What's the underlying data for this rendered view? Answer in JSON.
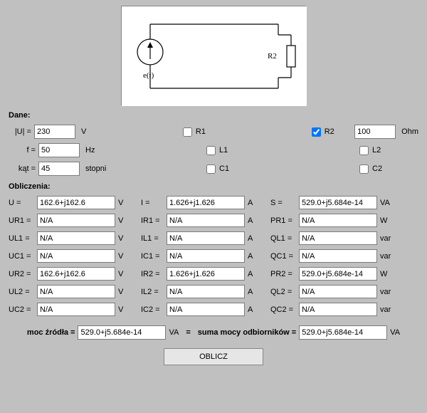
{
  "schematic": {
    "source_label": "e(t)",
    "load_label": "R2"
  },
  "sections": {
    "dane": "Dane:",
    "obliczenia": "Obliczenia:"
  },
  "dane": {
    "u_label": "|U| =",
    "u_value": "230",
    "u_unit": "V",
    "f_label": "f =",
    "f_value": "50",
    "f_unit": "Hz",
    "a_label": "kąt =",
    "a_value": "45",
    "a_unit": "stopni",
    "r1_label": "R1",
    "r1_checked": false,
    "l1_label": "L1",
    "l1_checked": false,
    "c1_label": "C1",
    "c1_checked": false,
    "r2_label": "R2",
    "r2_checked": true,
    "r2_value": "100",
    "r2_unit": "Ohm",
    "l2_label": "L2",
    "l2_checked": false,
    "c2_label": "C2",
    "c2_checked": false
  },
  "obl": {
    "col1_unit": "V",
    "col2_unit": "A",
    "rows": [
      {
        "l1": "U =",
        "v1": "162.6+j162.6",
        "l2": "I =",
        "v2": "1.626+j1.626",
        "l3": "S =",
        "v3": "529.0+j5.684e-14",
        "u3": "VA"
      },
      {
        "l1": "UR1 =",
        "v1": "N/A",
        "l2": "IR1 =",
        "v2": "N/A",
        "l3": "PR1 =",
        "v3": "N/A",
        "u3": "W"
      },
      {
        "l1": "UL1 =",
        "v1": "N/A",
        "l2": "IL1 =",
        "v2": "N/A",
        "l3": "QL1 =",
        "v3": "N/A",
        "u3": "var"
      },
      {
        "l1": "UC1 =",
        "v1": "N/A",
        "l2": "IC1 =",
        "v2": "N/A",
        "l3": "QC1 =",
        "v3": "N/A",
        "u3": "var"
      },
      {
        "l1": "UR2 =",
        "v1": "162.6+j162.6",
        "l2": "IR2 =",
        "v2": "1.626+j1.626",
        "l3": "PR2 =",
        "v3": "529.0+j5.684e-14",
        "u3": "W"
      },
      {
        "l1": "UL2 =",
        "v1": "N/A",
        "l2": "IL2 =",
        "v2": "N/A",
        "l3": "QL2 =",
        "v3": "N/A",
        "u3": "var"
      },
      {
        "l1": "UC2 =",
        "v1": "N/A",
        "l2": "IC2 =",
        "v2": "N/A",
        "l3": "QC2 =",
        "v3": "N/A",
        "u3": "var"
      }
    ]
  },
  "bottom": {
    "src_label": "moc źródła =",
    "src_value": "529.0+j5.684e-14",
    "va_unit": "VA",
    "eq": "=",
    "sum_label": "suma mocy odbiorników =",
    "sum_value": "529.0+j5.684e-14"
  },
  "button": {
    "label": "OBLICZ"
  }
}
